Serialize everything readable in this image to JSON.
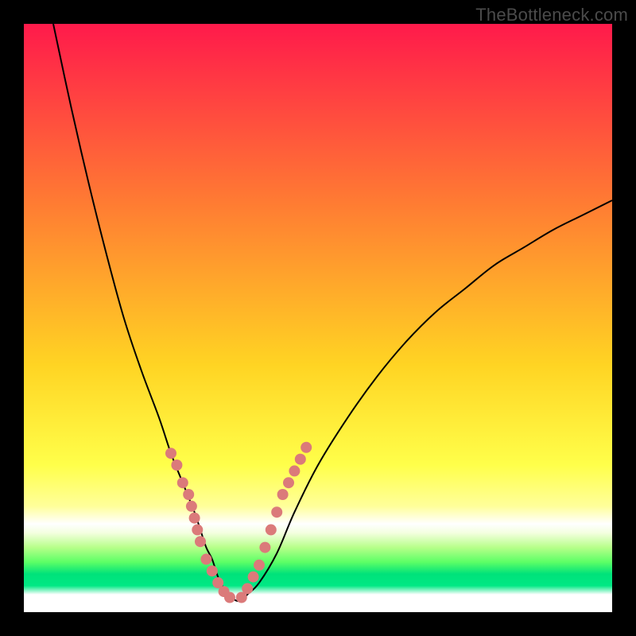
{
  "watermark": "TheBottleneck.com",
  "colors": {
    "black": "#000000",
    "curve": "#000000",
    "dots": "#db7a7a",
    "grad_top": "#ff1a4b",
    "grad_mid1": "#ff7a33",
    "grad_mid2": "#ffd423",
    "grad_band_pale": "#ffff9a",
    "grad_band_green1": "#7dff6a",
    "grad_band_green2": "#00e27a",
    "grad_white": "#ffffff"
  },
  "chart_data": {
    "type": "line",
    "title": "",
    "xlabel": "",
    "ylabel": "",
    "xlim": [
      0,
      100
    ],
    "ylim": [
      0,
      100
    ],
    "series": [
      {
        "name": "bottleneck-curve",
        "x": [
          5,
          8,
          11,
          14,
          17,
          20,
          23,
          25,
          27,
          29,
          30,
          31,
          32,
          33,
          34,
          35,
          36,
          37,
          38,
          40,
          43,
          46,
          50,
          55,
          60,
          65,
          70,
          75,
          80,
          85,
          90,
          95,
          100
        ],
        "y": [
          100,
          86,
          73,
          61,
          50,
          41,
          33,
          27,
          22,
          17,
          14,
          11,
          9,
          6,
          4,
          3,
          2,
          2,
          3,
          5,
          10,
          17,
          25,
          33,
          40,
          46,
          51,
          55,
          59,
          62,
          65,
          67.5,
          70
        ]
      }
    ],
    "highlight_dots": {
      "name": "marked-points",
      "x": [
        25,
        26,
        27,
        28,
        28.5,
        29,
        29.5,
        30,
        31,
        32,
        33,
        34,
        35,
        37,
        38,
        39,
        40,
        41,
        42,
        43,
        44,
        45,
        46,
        47,
        48
      ],
      "y": [
        27,
        25,
        22,
        20,
        18,
        16,
        14,
        12,
        9,
        7,
        5,
        3.5,
        2.5,
        2.5,
        4,
        6,
        8,
        11,
        14,
        17,
        20,
        22,
        24,
        26,
        28
      ]
    }
  }
}
